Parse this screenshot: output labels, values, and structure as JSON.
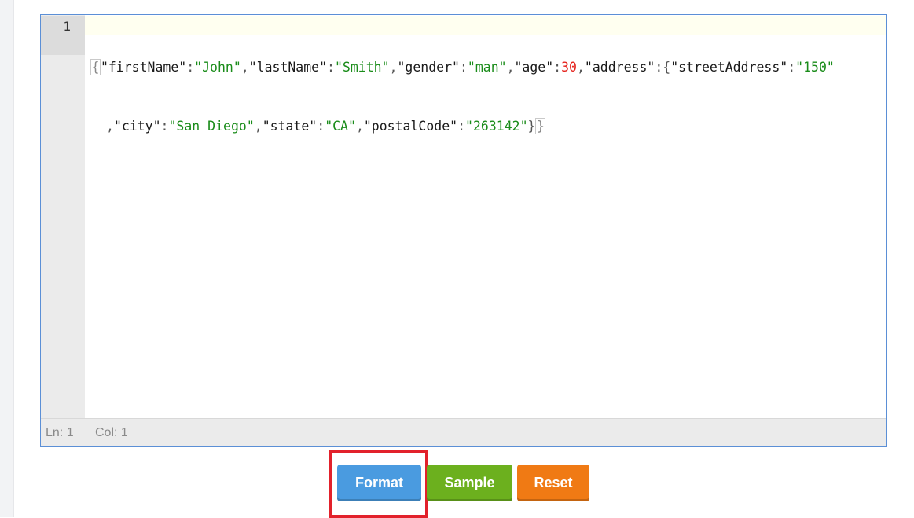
{
  "editor": {
    "line_number": "1",
    "code_tokens_line1": [
      {
        "t": "{",
        "c": "br"
      },
      {
        "t": "\"firstName\"",
        "c": "k"
      },
      {
        "t": ":",
        "c": "p"
      },
      {
        "t": "\"John\"",
        "c": "s"
      },
      {
        "t": ",",
        "c": "p"
      },
      {
        "t": "\"lastName\"",
        "c": "k"
      },
      {
        "t": ":",
        "c": "p"
      },
      {
        "t": "\"Smith\"",
        "c": "s"
      },
      {
        "t": ",",
        "c": "p"
      },
      {
        "t": "\"gender\"",
        "c": "k"
      },
      {
        "t": ":",
        "c": "p"
      },
      {
        "t": "\"man\"",
        "c": "s"
      },
      {
        "t": ",",
        "c": "p"
      },
      {
        "t": "\"age\"",
        "c": "k"
      },
      {
        "t": ":",
        "c": "p"
      },
      {
        "t": "30",
        "c": "n"
      },
      {
        "t": ",",
        "c": "p"
      },
      {
        "t": "\"address\"",
        "c": "k"
      },
      {
        "t": ":",
        "c": "p"
      },
      {
        "t": "{",
        "c": "p"
      },
      {
        "t": "\"streetAddress\"",
        "c": "k"
      },
      {
        "t": ":",
        "c": "p"
      },
      {
        "t": "\"150\"",
        "c": "s"
      }
    ],
    "code_tokens_line2": [
      {
        "t": ",",
        "c": "p"
      },
      {
        "t": "\"city\"",
        "c": "k"
      },
      {
        "t": ":",
        "c": "p"
      },
      {
        "t": "\"San Diego\"",
        "c": "s"
      },
      {
        "t": ",",
        "c": "p"
      },
      {
        "t": "\"state\"",
        "c": "k"
      },
      {
        "t": ":",
        "c": "p"
      },
      {
        "t": "\"CA\"",
        "c": "s"
      },
      {
        "t": ",",
        "c": "p"
      },
      {
        "t": "\"postalCode\"",
        "c": "k"
      },
      {
        "t": ":",
        "c": "p"
      },
      {
        "t": "\"263142\"",
        "c": "s"
      },
      {
        "t": "}",
        "c": "p"
      },
      {
        "t": "}",
        "c": "br"
      }
    ],
    "status": {
      "line": "Ln: 1",
      "col": "Col: 1"
    }
  },
  "buttons": {
    "format": "Format",
    "sample": "Sample",
    "reset": "Reset"
  },
  "colors": {
    "format": "#4a9be0",
    "sample": "#6cb01e",
    "reset": "#f07a14",
    "highlight": "#e2212b",
    "string": "#1a8c1a",
    "number": "#e5251f"
  }
}
